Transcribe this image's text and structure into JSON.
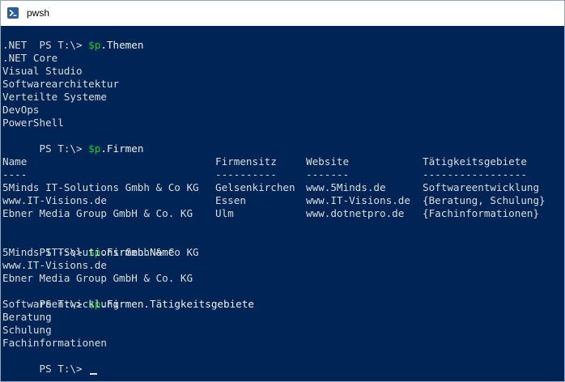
{
  "window": {
    "title": "pwsh",
    "accent": "#012456",
    "title_bar_color": "#ffffff"
  },
  "icons": {
    "app": "powershell-icon"
  },
  "console": {
    "prompt": "PS T:\\> ",
    "commands": [
      {
        "var": "$p",
        "rest": ".Themen"
      },
      {
        "var": "$p",
        "rest": ".Firmen"
      },
      {
        "var": "$p",
        "rest": ".Firmen.Name"
      },
      {
        "var": "$p",
        "rest": ".Firmen.Tätigkeitsgebiete"
      }
    ],
    "themen_output": [
      ".NET",
      ".NET Core",
      "Visual Studio",
      "Softwarearchitektur",
      "Verteilte Systeme",
      "DevOps",
      "PowerShell"
    ],
    "firmen_table": {
      "headers": [
        "Name",
        "Firmensitz",
        "Website",
        "Tätigkeitsgebiete"
      ],
      "separators": [
        "----",
        "----------",
        "-------",
        "-----------------"
      ],
      "rows": [
        [
          "5Minds IT-Solutions Gmbh & Co KG",
          "Gelsenkirchen",
          "www.5Minds.de",
          "Softwareentwicklung"
        ],
        [
          "www.IT-Visions.de",
          "Essen",
          "www.IT-Visions.de",
          "{Beratung, Schulung}"
        ],
        [
          "Ebner Media Group GmbH & Co. KG",
          "Ulm",
          "www.dotnetpro.de",
          "{Fachinformationen}"
        ]
      ]
    },
    "names_output": [
      "5Minds IT-Solutions Gmbh & Co KG",
      "www.IT-Visions.de",
      "Ebner Media Group GmbH & Co. KG"
    ],
    "taetigkeiten_output": [
      "Softwareentwicklung",
      "Beratung",
      "Schulung",
      "Fachinformationen"
    ],
    "colors": {
      "background": "#012456",
      "text": "#dcdcdc",
      "variable": "#28c828"
    }
  }
}
